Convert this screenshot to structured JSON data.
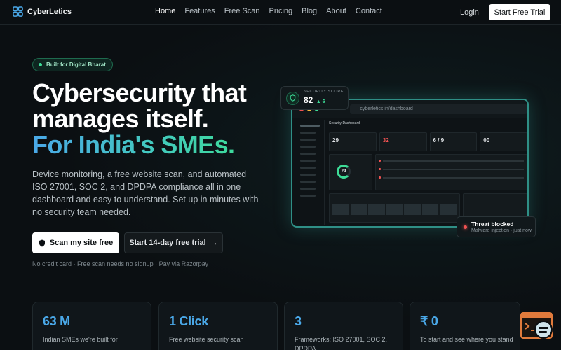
{
  "nav": {
    "brand": "CyberLetics",
    "links": [
      {
        "label": "Home",
        "active": true
      },
      {
        "label": "Features",
        "active": false
      },
      {
        "label": "Free Scan",
        "active": false
      },
      {
        "label": "Pricing",
        "active": false
      },
      {
        "label": "Blog",
        "active": false
      },
      {
        "label": "About",
        "active": false
      },
      {
        "label": "Contact",
        "active": false
      }
    ],
    "login": "Login",
    "cta": "Start Free Trial"
  },
  "hero": {
    "badge": "Built for Digital Bharat",
    "headline_line1": "Cybersecurity that",
    "headline_line2": "manages itself.",
    "headline_line3": "For India's SMEs.",
    "subtext": "Device monitoring, a free website scan, and automated ISO 27001, SOC 2, and DPDPA compliance all in one dashboard and easy to understand. Set up in minutes with no security team needed.",
    "primary_button": "Scan my site free",
    "secondary_button": "Start 14-day free trial",
    "fineprint": "No credit card · Free scan needs no signup · Pay via Razorpay"
  },
  "mockup": {
    "url": "cyberletics.in/dashboard",
    "title": "Security Dashboard",
    "stats": [
      {
        "value": "29",
        "color": "#e6e9ec"
      },
      {
        "value": "32",
        "color": "#f05252"
      },
      {
        "value": "6 / 9",
        "color": "#e6e9ec"
      },
      {
        "value": "00",
        "color": "#e6e9ec"
      }
    ],
    "ring_value": "29"
  },
  "score_card": {
    "label": "SECURITY SCORE",
    "value": "82",
    "delta": "▲ 6"
  },
  "threat_card": {
    "title": "Threat blocked",
    "subtitle": "Malware injection · just now"
  },
  "stat_cards": [
    {
      "value": "63 M",
      "label": "Indian SMEs we're built for"
    },
    {
      "value": "1 Click",
      "label": "Free website security scan"
    },
    {
      "value": "3",
      "label": "Frameworks: ISO 27001, SOC 2, DPDPA"
    },
    {
      "value": "₹ 0",
      "label": "To start and see where you stand"
    }
  ],
  "colors": {
    "accent_blue": "#4aa8e8",
    "accent_green": "#3ddc97",
    "danger": "#f05252"
  }
}
